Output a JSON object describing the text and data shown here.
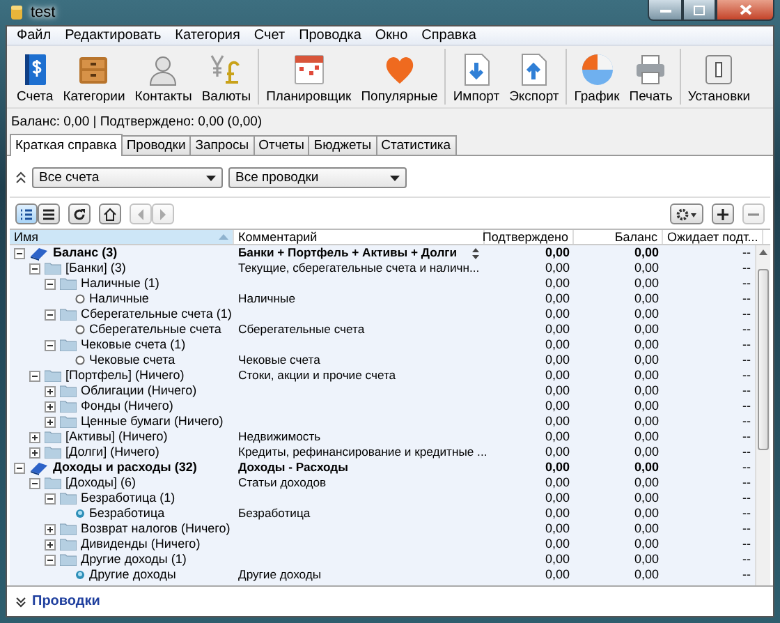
{
  "window": {
    "title": "test"
  },
  "menu": [
    "Файл",
    "Редактировать",
    "Категория",
    "Счет",
    "Проводка",
    "Окно",
    "Справка"
  ],
  "toolbar_groups": [
    {
      "buttons": [
        {
          "label": "Счета",
          "kind": "accounts"
        },
        {
          "label": "Категории",
          "kind": "categories"
        },
        {
          "label": "Контакты",
          "kind": "contacts"
        },
        {
          "label": "Валюты",
          "kind": "currencies"
        }
      ]
    },
    {
      "buttons": [
        {
          "label": "Планировщик",
          "kind": "scheduler"
        },
        {
          "label": "Популярные",
          "kind": "favorites"
        }
      ]
    },
    {
      "buttons": [
        {
          "label": "Импорт",
          "kind": "import"
        },
        {
          "label": "Экспорт",
          "kind": "export"
        }
      ]
    },
    {
      "buttons": [
        {
          "label": "График",
          "kind": "chart"
        },
        {
          "label": "Печать",
          "kind": "print"
        }
      ]
    },
    {
      "buttons": [
        {
          "label": "Установки",
          "kind": "settings"
        }
      ]
    }
  ],
  "summary": "Баланс: 0,00 | Подтверждено: 0,00 (0,00)",
  "tabs": [
    {
      "label": "Краткая справка",
      "selected": true
    },
    {
      "label": "Проводки",
      "selected": false
    },
    {
      "label": "Запросы",
      "selected": false
    },
    {
      "label": "Отчеты",
      "selected": false
    },
    {
      "label": "Бюджеты",
      "selected": false
    },
    {
      "label": "Статистика",
      "selected": false
    }
  ],
  "filters": [
    {
      "value": "Все счета"
    },
    {
      "value": "Все проводки"
    }
  ],
  "view_buttons": [
    {
      "kind": "tree",
      "selected": true
    },
    {
      "kind": "flat",
      "selected": false
    }
  ],
  "nav_buttons": [
    {
      "kind": "back",
      "disabled": true
    },
    {
      "kind": "forward",
      "disabled": true
    }
  ],
  "right_buttons": [
    {
      "kind": "settings",
      "disabled": false
    },
    {
      "kind": "add",
      "disabled": false
    },
    {
      "kind": "remove",
      "disabled": true
    }
  ],
  "table": {
    "columns": [
      {
        "label": "Имя",
        "sorted": true
      },
      {
        "label": "Комментарий",
        "sorted": false
      },
      {
        "label": "Подтверждено",
        "sorted": false
      },
      {
        "label": "Баланс",
        "sorted": false
      },
      {
        "label": "Ожидает подт...",
        "sorted": false
      }
    ],
    "rows": [
      {
        "kind": "root",
        "name": "Баланс (3)",
        "comment": "Банки + Портфель + Активы + Долги",
        "confirmed": "0,00",
        "balance": "0,00",
        "pending": "--",
        "expanded": true,
        "children": [
          {
            "kind": "folder",
            "name": "[Банки] (3)",
            "comment": "Текущие, сберегательные счета и наличн...",
            "confirmed": "0,00",
            "balance": "0,00",
            "pending": "--",
            "expanded": true,
            "children": [
              {
                "kind": "folder",
                "name": "Наличные (1)",
                "confirmed": "0,00",
                "balance": "0,00",
                "pending": "--",
                "expanded": true,
                "children": [
                  {
                    "kind": "account",
                    "name": "Наличные",
                    "comment": "Наличные",
                    "confirmed": "0,00",
                    "balance": "0,00",
                    "pending": "--"
                  }
                ]
              },
              {
                "kind": "folder",
                "name": "Сберегательные счета (1)",
                "confirmed": "0,00",
                "balance": "0,00",
                "pending": "--",
                "expanded": true,
                "children": [
                  {
                    "kind": "account",
                    "name": "Сберегательные счета",
                    "comment": "Сберегательные счета",
                    "confirmed": "0,00",
                    "balance": "0,00",
                    "pending": "--"
                  }
                ]
              },
              {
                "kind": "folder",
                "name": "Чековые счета (1)",
                "confirmed": "0,00",
                "balance": "0,00",
                "pending": "--",
                "expanded": true,
                "children": [
                  {
                    "kind": "account",
                    "name": "Чековые счета",
                    "comment": "Чековые счета",
                    "confirmed": "0,00",
                    "balance": "0,00",
                    "pending": "--"
                  }
                ]
              }
            ]
          },
          {
            "kind": "folder",
            "name": "[Портфель] (Ничего)",
            "comment": "Стоки, акции и прочие счета",
            "confirmed": "0,00",
            "balance": "0,00",
            "pending": "--",
            "expanded": true,
            "children": [
              {
                "kind": "folder",
                "name": "Облигации (Ничего)",
                "confirmed": "0,00",
                "balance": "0,00",
                "pending": "--",
                "expanded": false
              },
              {
                "kind": "folder",
                "name": "Фонды (Ничего)",
                "confirmed": "0,00",
                "balance": "0,00",
                "pending": "--",
                "expanded": false
              },
              {
                "kind": "folder",
                "name": "Ценные бумаги (Ничего)",
                "confirmed": "0,00",
                "balance": "0,00",
                "pending": "--",
                "expanded": false
              }
            ]
          },
          {
            "kind": "folder",
            "name": "[Активы] (Ничего)",
            "comment": "Недвижимость",
            "confirmed": "0,00",
            "balance": "0,00",
            "pending": "--",
            "expanded": false
          },
          {
            "kind": "folder",
            "name": "[Долги] (Ничего)",
            "comment": "Кредиты, рефинансирование и кредитные ...",
            "confirmed": "0,00",
            "balance": "0,00",
            "pending": "--",
            "expanded": false
          }
        ]
      },
      {
        "kind": "root",
        "name": "Доходы и расходы (32)",
        "comment": "Доходы - Расходы",
        "confirmed": "0,00",
        "balance": "0,00",
        "pending": "--",
        "expanded": true,
        "children": [
          {
            "kind": "folder",
            "name": "[Доходы] (6)",
            "comment": "Статьи доходов",
            "confirmed": "0,00",
            "balance": "0,00",
            "pending": "--",
            "expanded": true,
            "children": [
              {
                "kind": "folder",
                "name": "Безработица (1)",
                "confirmed": "0,00",
                "balance": "0,00",
                "pending": "--",
                "expanded": true,
                "children": [
                  {
                    "kind": "category",
                    "name": "Безработица",
                    "comment": "Безработица",
                    "confirmed": "0,00",
                    "balance": "0,00",
                    "pending": "--"
                  }
                ]
              },
              {
                "kind": "folder",
                "name": "Возврат налогов (Ничего)",
                "confirmed": "0,00",
                "balance": "0,00",
                "pending": "--",
                "expanded": false
              },
              {
                "kind": "folder",
                "name": "Дивиденды (Ничего)",
                "confirmed": "0,00",
                "balance": "0,00",
                "pending": "--",
                "expanded": false
              },
              {
                "kind": "folder",
                "name": "Другие доходы (1)",
                "confirmed": "0,00",
                "balance": "0,00",
                "pending": "--",
                "expanded": true,
                "children": [
                  {
                    "kind": "category",
                    "name": "Другие доходы",
                    "comment": "Другие доходы",
                    "confirmed": "0,00",
                    "balance": "0,00",
                    "pending": "--"
                  }
                ]
              }
            ]
          }
        ]
      }
    ]
  },
  "footer": {
    "label": "Проводки"
  }
}
